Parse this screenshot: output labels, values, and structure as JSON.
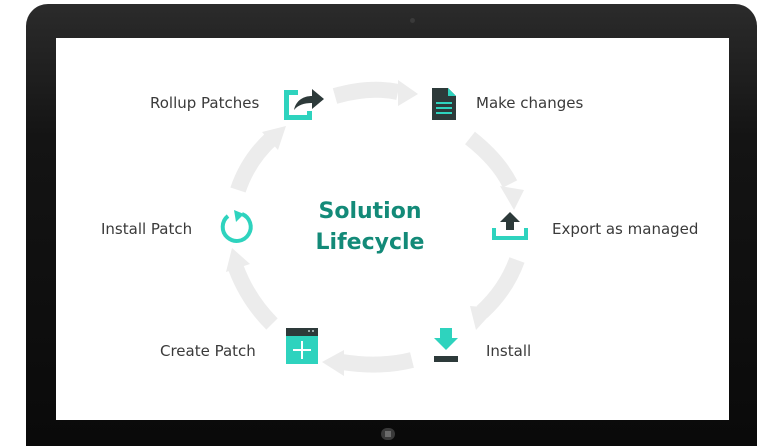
{
  "diagram": {
    "title_line1": "Solution",
    "title_line2": "Lifecycle",
    "steps": [
      {
        "label": "Make changes",
        "icon": "document-icon"
      },
      {
        "label": "Export as managed",
        "icon": "upload-tray-icon"
      },
      {
        "label": "Install",
        "icon": "download-icon"
      },
      {
        "label": "Create Patch",
        "icon": "window-plus-icon"
      },
      {
        "label": "Install Patch",
        "icon": "refresh-arc-icon"
      },
      {
        "label": "Rollup Patches",
        "icon": "share-arrow-icon"
      }
    ]
  },
  "colors": {
    "accent": "#2ed3be",
    "title": "#138a78",
    "icon_dark": "#2d3a3a",
    "cycle_arrow": "#eeeeee",
    "bezel": "#111111"
  }
}
